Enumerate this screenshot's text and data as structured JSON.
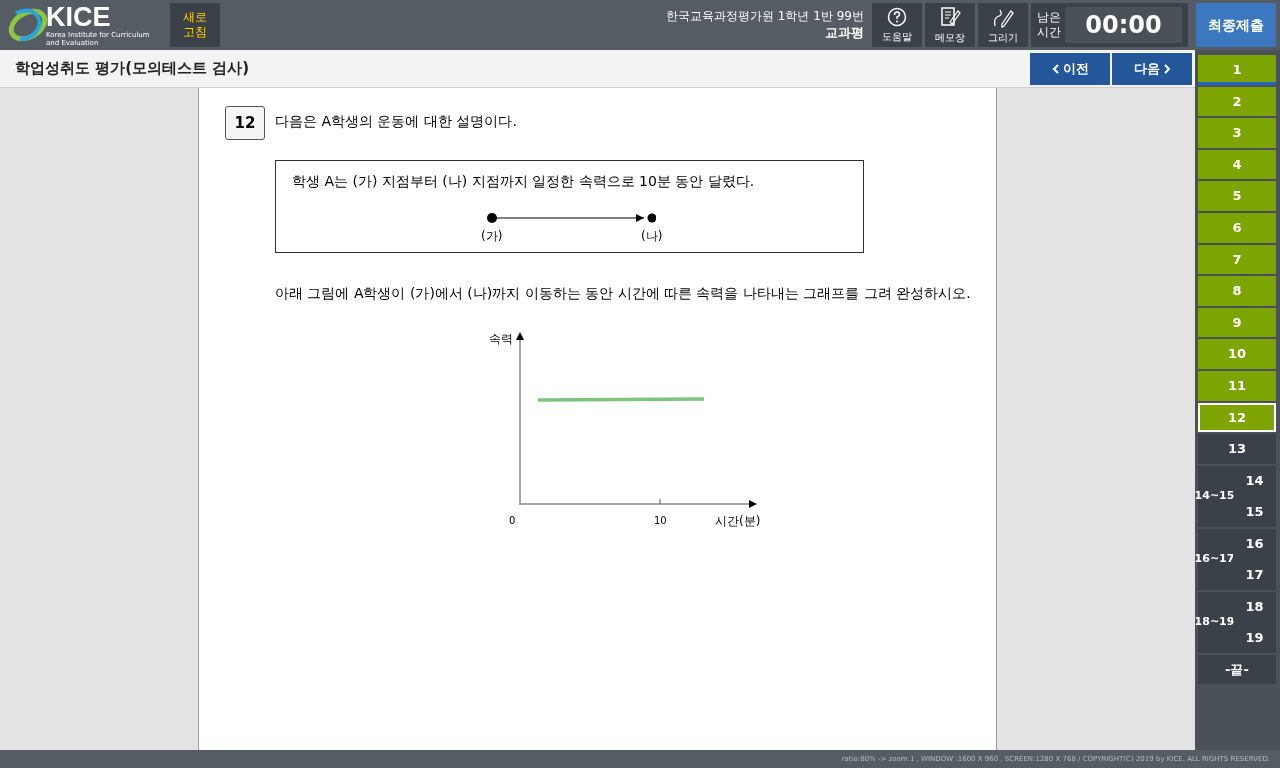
{
  "header": {
    "logo": {
      "name": "KICE",
      "subtitle": "Korea Institute for Curriculum and Evaluation"
    },
    "refresh_button": "새로\n고침",
    "examinee": "한국교육과정평가원 1학년 1반 99번",
    "subject": "교과평",
    "tools": [
      {
        "label": "도움말",
        "kind": "help"
      },
      {
        "label": "메모장",
        "kind": "memo"
      },
      {
        "label": "그리기",
        "kind": "draw"
      }
    ],
    "timer": {
      "label": "남은\n시간",
      "value": "00:00"
    },
    "submit_button": "최종제출"
  },
  "title_bar": {
    "title": "학업성취도 평가(모의테스트 검사)",
    "prev_button": "이전",
    "next_button": "다음"
  },
  "question": {
    "number": "12",
    "prompt": "다음은 A학생의 운동에 대한 설명이다.",
    "box_text": "학생 A는 (가) 지점부터 (나) 지점까지 일정한 속력으로 10분 동안 달렸다.",
    "points": [
      "(가)",
      "(나)"
    ],
    "instruction": "아래 그림에 A학생이 (가)에서 (나)까지 이동하는 동안 시간에 따른 속력을 나타내는 그래프를 그려 완성하시오.",
    "graph": {
      "ylabel": "속력",
      "xlabel": "시간(분)",
      "xticks": [
        "0",
        "10"
      ],
      "answer_line": {
        "drawn": true,
        "color": "#7dc47d"
      }
    }
  },
  "question_nav": [
    {
      "label": "1",
      "answered": true,
      "selected": false,
      "flagged": true
    },
    {
      "label": "2",
      "answered": true,
      "selected": false,
      "flagged": false
    },
    {
      "label": "3",
      "answered": true,
      "selected": false,
      "flagged": false
    },
    {
      "label": "4",
      "answered": true,
      "selected": false,
      "flagged": false
    },
    {
      "label": "5",
      "answered": true,
      "selected": false,
      "flagged": false
    },
    {
      "label": "6",
      "answered": true,
      "selected": false,
      "flagged": false
    },
    {
      "label": "7",
      "answered": true,
      "selected": false,
      "flagged": false
    },
    {
      "label": "8",
      "answered": true,
      "selected": false,
      "flagged": false
    },
    {
      "label": "9",
      "answered": true,
      "selected": false,
      "flagged": false
    },
    {
      "label": "10",
      "answered": true,
      "selected": false,
      "flagged": false
    },
    {
      "label": "11",
      "answered": true,
      "selected": false,
      "flagged": false
    },
    {
      "label": "12",
      "answered": true,
      "selected": true,
      "flagged": false
    },
    {
      "label": "13",
      "answered": false,
      "selected": false,
      "flagged": false
    },
    {
      "label": "14~15",
      "children": [
        {
          "label": "14",
          "answered": false,
          "selected": false,
          "flagged": false
        },
        {
          "label": "15",
          "answered": false,
          "selected": false,
          "flagged": false
        }
      ]
    },
    {
      "label": "16~17",
      "children": [
        {
          "label": "16",
          "answered": false,
          "selected": false,
          "flagged": false
        },
        {
          "label": "17",
          "answered": false,
          "selected": false,
          "flagged": false
        }
      ]
    },
    {
      "label": "18~19",
      "children": [
        {
          "label": "18",
          "answered": false,
          "selected": false,
          "flagged": false
        },
        {
          "label": "19",
          "answered": false,
          "selected": false,
          "flagged": false
        }
      ]
    },
    {
      "label": "-끝-",
      "answered": false,
      "selected": false,
      "flagged": false
    }
  ],
  "status_bar": "ratio:80% -> zoom:1 , WINDOW :1600 X 960 , SCREEN:1280 X 768 / COPYRIGHT(C) 2019 by KICE. ALL RIGHTS RESERVED."
}
